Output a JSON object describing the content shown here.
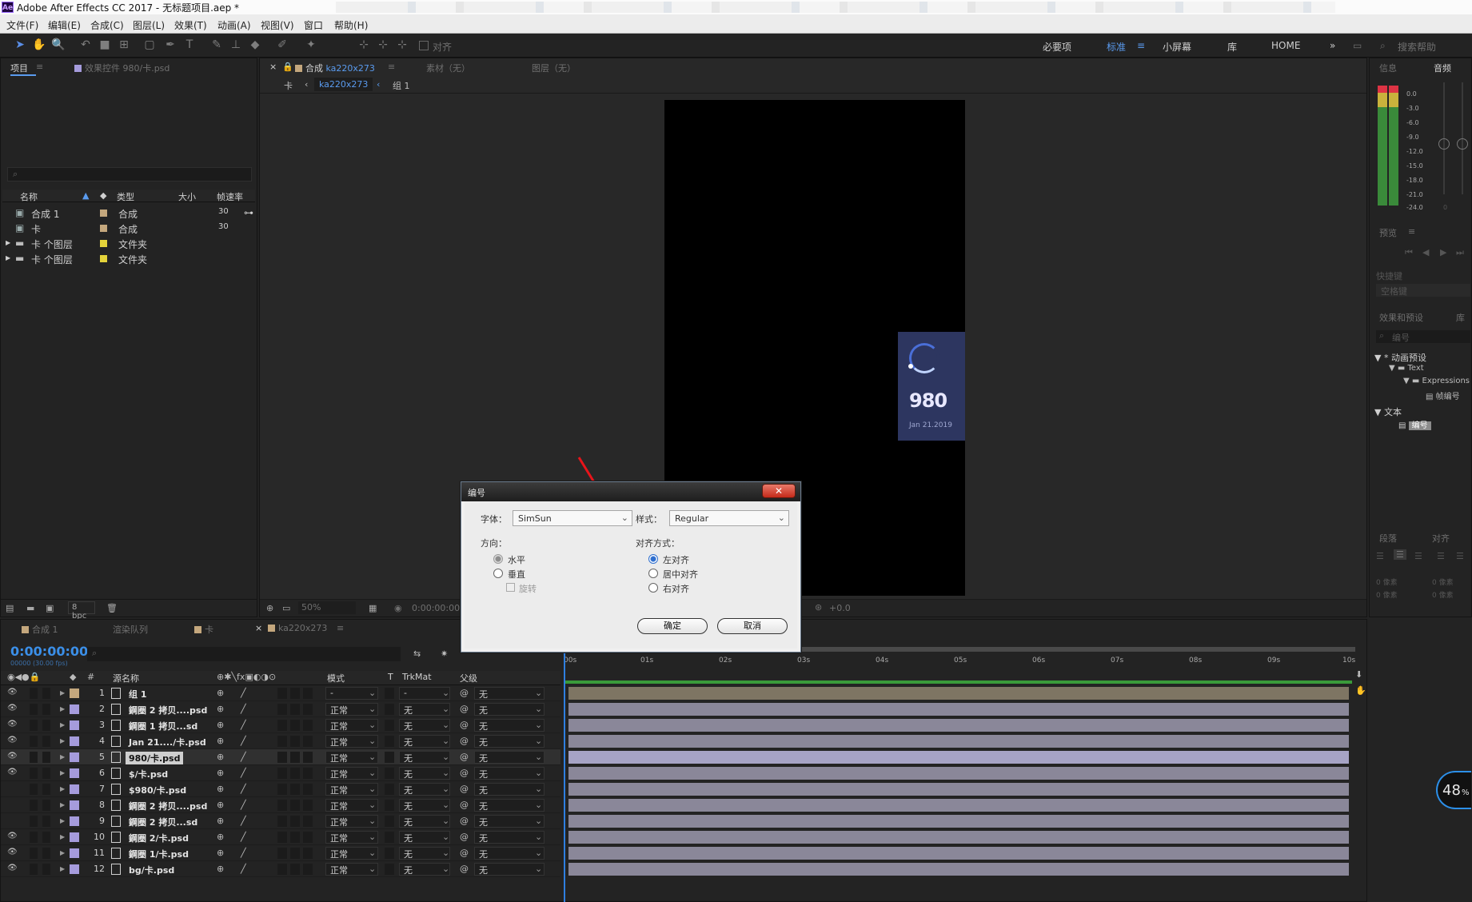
{
  "window": {
    "app_badge": "Ae",
    "title": "Adobe After Effects CC 2017 - 无标题项目.aep *"
  },
  "menu": [
    "文件(F)",
    "编辑(E)",
    "合成(C)",
    "图层(L)",
    "效果(T)",
    "动画(A)",
    "视图(V)",
    "窗口",
    "帮助(H)"
  ],
  "toolbar": {
    "align_label": "对齐",
    "workspaces": [
      "必要项",
      "标准",
      "小屏幕",
      "库",
      "HOME"
    ],
    "selected_workspace": "标准",
    "search_placeholder": "搜索帮助"
  },
  "project_panel": {
    "tab_project": "项目",
    "tab_effects": "效果控件 980/卡.psd",
    "search_placeholder": "",
    "columns": [
      "名称",
      "类型",
      "大小",
      "帧速率"
    ],
    "items": [
      {
        "name": "合成 1",
        "type": "合成",
        "fps": "30",
        "kind": "comp"
      },
      {
        "name": "卡",
        "type": "合成",
        "fps": "30",
        "kind": "comp"
      },
      {
        "name": "卡 个图层",
        "type": "文件夹",
        "fps": "",
        "kind": "folder"
      },
      {
        "name": "卡 个图层",
        "type": "文件夹",
        "fps": "",
        "kind": "folder"
      }
    ],
    "bpc": "8 bpc"
  },
  "composition_panel": {
    "tab_comp_prefix": "合成",
    "tab_comp": "ka220x273",
    "tab_footage": "素材（无）",
    "tab_layer": "图层（无）",
    "breadcrumb": [
      "卡",
      "ka220x273",
      "组 1"
    ],
    "zoom": "50%",
    "timecode": "0:00:00:00",
    "exposure": "+0.0",
    "card_number": "980",
    "card_date": "Jan 21.2019"
  },
  "dialog": {
    "title": "编号",
    "font_label": "字体：",
    "font_value": "SimSun",
    "style_label": "样式：",
    "style_value": "Regular",
    "direction_label": "方向：",
    "direction_options": [
      "水平",
      "垂直"
    ],
    "rotate_label": "旋转",
    "align_label": "对齐方式：",
    "align_options": [
      "左对齐",
      "居中对齐",
      "右对齐"
    ],
    "ok": "确定",
    "cancel": "取消"
  },
  "right_panel": {
    "tab_info": "信息",
    "tab_audio": "音频",
    "db_levels": [
      "0.0",
      "-3.0",
      "-6.0",
      "-9.0",
      "-12.0",
      "-15.0",
      "-18.0",
      "-21.0",
      "-24.0"
    ],
    "meter_zero": "0",
    "tab_preview": "预览",
    "shortcut": "快捷键",
    "shortcut_value": "空格键",
    "tab_effects_presets": "效果和预设",
    "tab_library": "库",
    "search_value": "编号",
    "tree": [
      {
        "label": "* 动画预设",
        "depth": 0
      },
      {
        "label": "Text",
        "depth": 1
      },
      {
        "label": "Expressions",
        "depth": 2
      },
      {
        "label": "帧编号",
        "depth": 3
      },
      {
        "label": "文本",
        "depth": 0
      },
      {
        "label": "编号",
        "depth": 1
      }
    ],
    "tab_paragraph": "段落",
    "tab_align": "对齐",
    "px_a": "0 像素",
    "px_b": "0 像素",
    "px_c": "0 像素",
    "px_d": "0 像素"
  },
  "timeline": {
    "tabs": [
      "合成 1",
      "渲染队列",
      "卡",
      "ka220x273"
    ],
    "timecode": "0:00:00:00",
    "fps_label": "00000 (30.00 fps)",
    "ruler": [
      "00s",
      "01s",
      "02s",
      "03s",
      "04s",
      "05s",
      "06s",
      "07s",
      "08s",
      "09s",
      "10s"
    ],
    "columns": {
      "source": "源名称",
      "mode": "模式",
      "t": "T",
      "trkmat": "TrkMat",
      "parent": "父级"
    },
    "layers": [
      {
        "num": "1",
        "name": "组 1",
        "mode": "-",
        "trk": "-",
        "parent": "无",
        "visible": true,
        "color": "#c4a77d",
        "group": true
      },
      {
        "num": "2",
        "name": "鋼圈 2 拷贝....psd",
        "mode": "正常",
        "trk": "无",
        "parent": "无",
        "visible": true,
        "color": "#a59bdc"
      },
      {
        "num": "3",
        "name": "鋼圈 1 拷贝...sd",
        "mode": "正常",
        "trk": "无",
        "parent": "无",
        "visible": true,
        "color": "#a59bdc"
      },
      {
        "num": "4",
        "name": "Jan 21..../卡.psd",
        "mode": "正常",
        "trk": "无",
        "parent": "无",
        "visible": true,
        "color": "#a59bdc"
      },
      {
        "num": "5",
        "name": "980/卡.psd",
        "mode": "正常",
        "trk": "无",
        "parent": "无",
        "visible": true,
        "color": "#a59bdc",
        "selected": true
      },
      {
        "num": "6",
        "name": "$/卡.psd",
        "mode": "正常",
        "trk": "无",
        "parent": "无",
        "visible": true,
        "color": "#a59bdc"
      },
      {
        "num": "7",
        "name": "$980/卡.psd",
        "mode": "正常",
        "trk": "无",
        "parent": "无",
        "visible": false,
        "color": "#a59bdc"
      },
      {
        "num": "8",
        "name": "鋼圈 2 拷贝....psd",
        "mode": "正常",
        "trk": "无",
        "parent": "无",
        "visible": false,
        "color": "#a59bdc"
      },
      {
        "num": "9",
        "name": "鋼圈 2 拷贝...sd",
        "mode": "正常",
        "trk": "无",
        "parent": "无",
        "visible": false,
        "color": "#a59bdc"
      },
      {
        "num": "10",
        "name": "鋼圈 2/卡.psd",
        "mode": "正常",
        "trk": "无",
        "parent": "无",
        "visible": true,
        "color": "#a59bdc"
      },
      {
        "num": "11",
        "name": "鋼圈 1/卡.psd",
        "mode": "正常",
        "trk": "无",
        "parent": "无",
        "visible": true,
        "color": "#a59bdc"
      },
      {
        "num": "12",
        "name": "bg/卡.psd",
        "mode": "正常",
        "trk": "无",
        "parent": "无",
        "visible": true,
        "color": "#a59bdc"
      }
    ]
  },
  "overlay": {
    "percent": "48",
    "percent_sign": "%"
  },
  "colors": {
    "accent": "#5a9bef",
    "card_bg": "#2d3660",
    "annotation_arrow": "#e8141a",
    "layer_bar": "#8a8799"
  }
}
